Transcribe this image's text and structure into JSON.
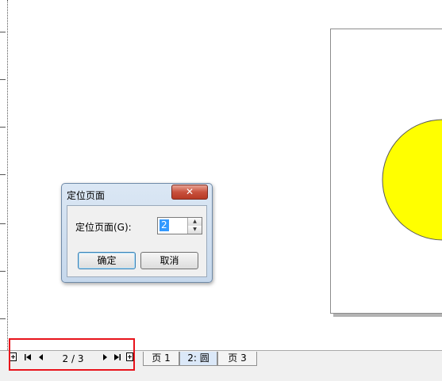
{
  "dialog": {
    "title": "定位页面",
    "close_label": "✕",
    "field_label": "定位页面(G):",
    "page_value": "2",
    "ok_label": "确定",
    "cancel_label": "取消"
  },
  "navigation": {
    "first_page_add_icon": "add-page-icon",
    "page_count": "2 / 3",
    "tabs": [
      {
        "label": "页 1",
        "active": false
      },
      {
        "label": "2: 圆",
        "active": true
      },
      {
        "label": "页 3",
        "active": false
      }
    ]
  },
  "colors": {
    "circle_fill": "#ffff00",
    "highlight_border": "#e8131b"
  }
}
